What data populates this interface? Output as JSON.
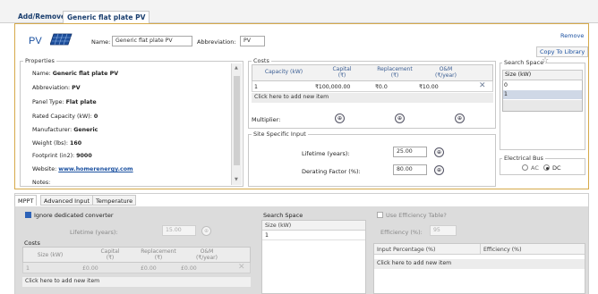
{
  "tabs": [
    "Add/Remove",
    "Generic flat plate PV"
  ],
  "header": {
    "component_label": "PV",
    "name_label": "Name:",
    "name_value": "Generic flat plate PV",
    "abbreviation_label": "Abbreviation:",
    "abbreviation_value": "PV",
    "remove_label": "Remove",
    "copy_label": "Copy To Library"
  },
  "properties": {
    "title": "Properties",
    "lines": [
      {
        "label": "Name:",
        "value": "Generic flat plate PV"
      },
      {
        "label": "Abbreviation:",
        "value": "PV"
      },
      {
        "label": "Panel Type:",
        "value": "Flat plate"
      },
      {
        "label": "Rated Capacity (kW):",
        "value": "0"
      },
      {
        "label": "Manufacturer:",
        "value": "Generic"
      },
      {
        "label": "Weight (lbs):",
        "value": "160"
      },
      {
        "label": "Footprint (in2):",
        "value": "9000"
      },
      {
        "label": "Website:",
        "value": "www.homerenergy.com"
      },
      {
        "label": "Notes:",
        "value": ""
      }
    ]
  },
  "costs": {
    "title": "Costs",
    "headers": [
      "Capacity (kW)",
      "Capital\n(₹)",
      "Replacement\n(₹)",
      "O&M\n(₹/year)"
    ],
    "rows": [
      [
        "1",
        "₹100,000.00",
        "₹0.0",
        "₹10.00"
      ]
    ],
    "add_row_label": "Click here to add new item",
    "multiplier_label": "Multiplier:"
  },
  "site": {
    "title": "Site Specific Input",
    "lifetime_label": "Lifetime (years):",
    "lifetime_value": "25.00",
    "derating_label": "Derating Factor (%):",
    "derating_value": "80.00"
  },
  "search_space": {
    "title": "Search Space",
    "header": "Size (kW)",
    "values": [
      "0",
      "1"
    ]
  },
  "electrical_bus": {
    "title": "Electrical Bus",
    "options": [
      "AC",
      "DC"
    ],
    "selected": "DC"
  },
  "subtabs": [
    "MPPT",
    "Advanced Input",
    "Temperature"
  ],
  "mppt": {
    "ignore_label": "Ignore dedicated converter",
    "lifetime_label": "Lifetime (years):",
    "lifetime_value": "15.00",
    "costs_title": "Costs",
    "headers": [
      "Size (kW)",
      "Capital\n(₹)",
      "Replacement\n(₹)",
      "O&M\n(₹/year)"
    ],
    "rows": [
      [
        "1",
        "£0.00",
        "£0.00",
        "£0.00"
      ]
    ],
    "add_row_label": "Click here to add new item",
    "search_title": "Search Space",
    "search_header": "Size (kW)",
    "search_values": [
      "1"
    ],
    "use_efficiency_label": "Use Efficiency Table?",
    "efficiency_label": "Efficiency (%):",
    "efficiency_value": "95",
    "eff_headers": [
      "Input Percentage (%)",
      "Efficiency (%)"
    ],
    "eff_add_row_label": "Click here to add new item"
  },
  "colors": {
    "accent_border": "#d6a94a",
    "header_text": "#3a5d93",
    "link": "#1a50a0"
  }
}
